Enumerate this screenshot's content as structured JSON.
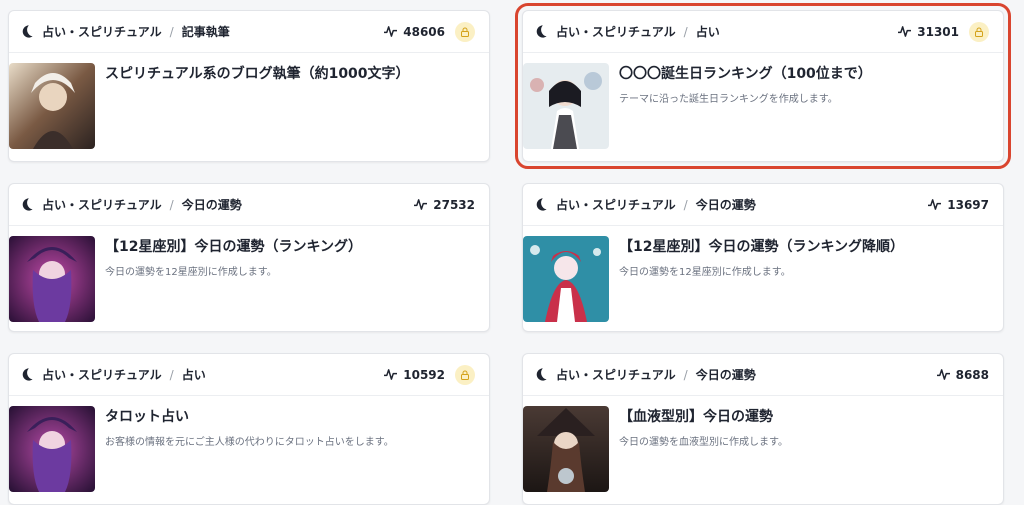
{
  "colors": {
    "highlight_border": "#d9452f",
    "lock_badge": "#fbf0c4"
  },
  "icons": {
    "category": "moon-icon",
    "stat": "activity-icon",
    "locked": "lock-icon"
  },
  "cards": [
    {
      "category": "占い・スピリチュアル",
      "subcategory": "記事執筆",
      "count": "48606",
      "locked": true,
      "selected": false,
      "title": "スピリチュアル系のブログ執筆（約1000文字）",
      "description": ""
    },
    {
      "category": "占い・スピリチュアル",
      "subcategory": "占い",
      "count": "31301",
      "locked": true,
      "selected": true,
      "title": "〇〇〇誕生日ランキング（100位まで）",
      "description": "テーマに沿った誕生日ランキングを作成します。"
    },
    {
      "category": "占い・スピリチュアル",
      "subcategory": "今日の運勢",
      "count": "27532",
      "locked": false,
      "selected": false,
      "title": "【12星座別】今日の運勢（ランキング）",
      "description": "今日の運勢を12星座別に作成します。"
    },
    {
      "category": "占い・スピリチュアル",
      "subcategory": "今日の運勢",
      "count": "13697",
      "locked": false,
      "selected": false,
      "title": "【12星座別】今日の運勢（ランキング降順）",
      "description": "今日の運勢を12星座別に作成します。"
    },
    {
      "category": "占い・スピリチュアル",
      "subcategory": "占い",
      "count": "10592",
      "locked": true,
      "selected": false,
      "title": "タロット占い",
      "description": "お客様の情報を元にご主人様の代わりにタロット占いをします。"
    },
    {
      "category": "占い・スピリチュアル",
      "subcategory": "今日の運勢",
      "count": "8688",
      "locked": false,
      "selected": false,
      "title": "【血液型別】今日の運勢",
      "description": "今日の運勢を血液型別に作成します。"
    }
  ]
}
